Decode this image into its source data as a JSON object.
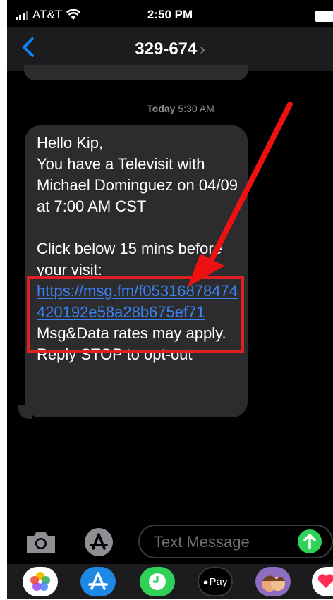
{
  "status_bar": {
    "carrier": "AT&T",
    "time": "2:50 PM"
  },
  "nav": {
    "contact": "329-674",
    "chevron": "›"
  },
  "thread": {
    "timestamp_day": "Today",
    "timestamp_time": "5:30 AM",
    "message": {
      "line1": "Hello Kip,",
      "line2": "You have a Televisit with Michael Dominguez on 04/09 at 7:00 AM CST",
      "line3": "Click below 15 mins before your visit:",
      "link": "https://msg.fm/f05316878474420192e58a28b675ef71",
      "line4": "Msg&Data rates may apply. Reply STOP to opt-out"
    }
  },
  "composer": {
    "placeholder": "Text Message"
  },
  "dock": {
    "pay_label": "Pay"
  },
  "colors": {
    "link": "#3b82f6",
    "highlight": "#e02020",
    "arrow": "#ee1111",
    "send": "#30d158"
  }
}
